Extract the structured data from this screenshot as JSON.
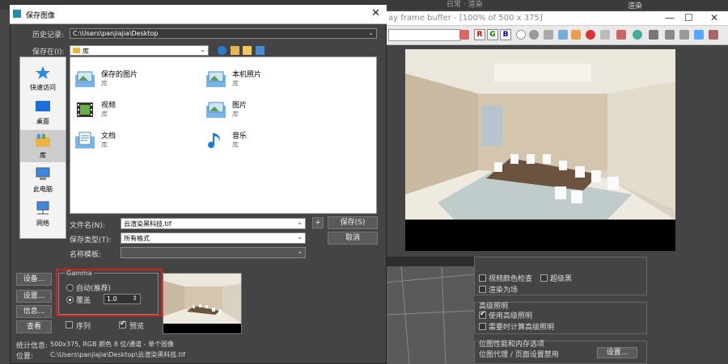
{
  "background_app": {
    "framebuffer_title": "ay frame buffer - [100% of 500 x 375]",
    "top_right_label": "渲染",
    "render_setup": {
      "checkbox_left": "",
      "overlay_label": "视频颜色检查",
      "overlay_checked": false,
      "super_black_label": "超级黑",
      "super_black_checked": false,
      "render_to_field_label": "渲染为场",
      "render_to_field_checked": false,
      "advanced_lighting_group": "高级照明",
      "use_advanced_lighting": "使用高级照明",
      "use_advanced_lighting_checked": true,
      "compute_advanced_lighting": "需要时计算高级照明",
      "compute_advanced_lighting_checked": false,
      "bitmap_group": "位图性能和内存选项",
      "bitmap_proxy_label": "位图代理 / 页面设置禁用",
      "settings_button": "设置..."
    }
  },
  "dialog": {
    "title": "保存图像",
    "close_glyph": "✕",
    "history_label": "历史记录:",
    "history_value": "C:\\Users\\panjiajia\\Desktop",
    "save_in_label": "保存在(I):",
    "save_in_value": "库",
    "places": [
      {
        "label": "快速访问",
        "icon": "star-icon"
      },
      {
        "label": "桌面",
        "icon": "desktop-icon"
      },
      {
        "label": "库",
        "icon": "library-icon"
      },
      {
        "label": "此电脑",
        "icon": "computer-icon"
      },
      {
        "label": "网络",
        "icon": "network-icon"
      }
    ],
    "files": [
      {
        "name": "保存的图片",
        "sub": "库",
        "icon": "pictures-folder-icon"
      },
      {
        "name": "本机照片",
        "sub": "库",
        "icon": "pictures-folder-icon"
      },
      {
        "name": "视频",
        "sub": "库",
        "icon": "video-folder-icon"
      },
      {
        "name": "图片",
        "sub": "库",
        "icon": "pictures-folder-icon"
      },
      {
        "name": "文档",
        "sub": "库",
        "icon": "documents-folder-icon"
      },
      {
        "name": "音乐",
        "sub": "库",
        "icon": "music-folder-icon"
      }
    ],
    "filename_label": "文件名(N):",
    "filename_value": "云渲染黑科技.tif",
    "filetype_label": "保存类型(T):",
    "filetype_value": "所有格式",
    "template_label": "名称模板:",
    "template_value": "",
    "plus_label": "+",
    "save_button": "保存(S)",
    "cancel_button": "取消",
    "devices_button": "设备...",
    "settings_button": "设置...",
    "info_button": "信息...",
    "view_button": "查看",
    "gamma": {
      "group_label": "Gamma",
      "auto_label": "自动(推荐)",
      "override_label": "覆盖",
      "override_value": "1.0",
      "selected": "override"
    },
    "sequence_label": "序列",
    "sequence_checked": false,
    "preview_label": "预览",
    "preview_checked": true,
    "stats_label": "统计信息:",
    "stats_value": "500x375, RGB 颜色 8 位/通道 - 单个图像",
    "location_label": "位置:",
    "location_value": "C:\\Users\\panjiajia\\Desktop\\云渲染黑科技.tif"
  },
  "colors": {
    "highlight_border": "#d02020",
    "dialog_bg": "#444444",
    "list_bg": "#ffffff"
  }
}
